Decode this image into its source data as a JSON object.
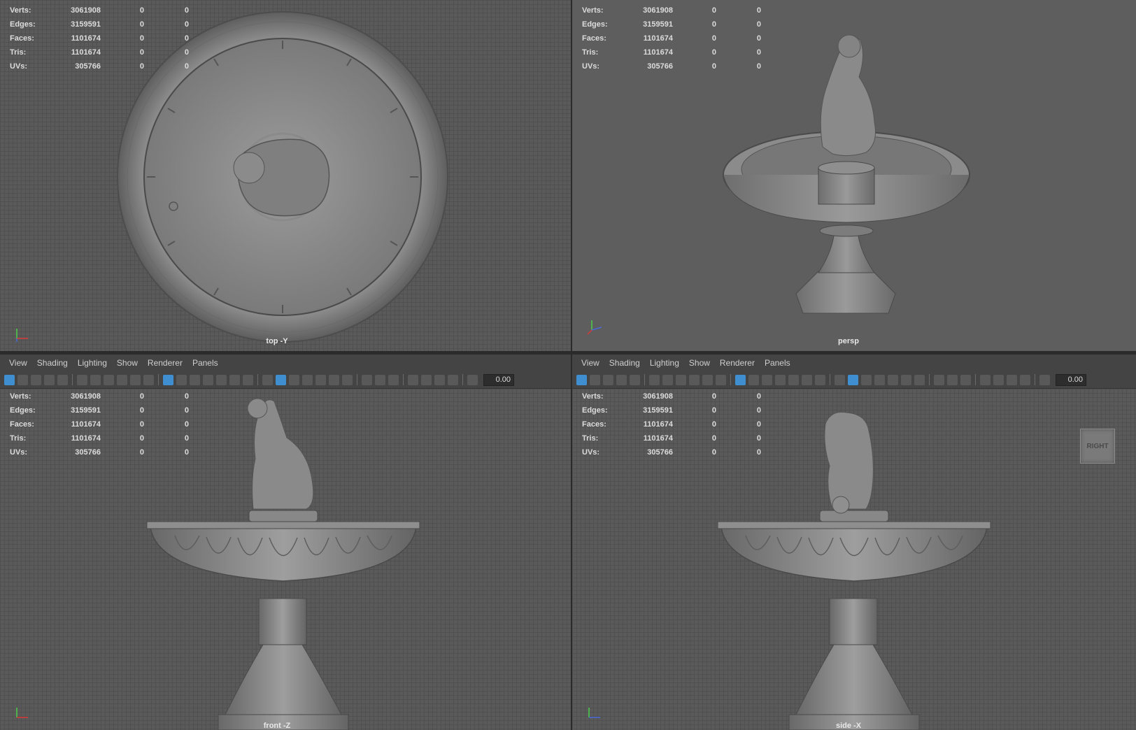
{
  "stats": {
    "rows": [
      {
        "label": "Verts:",
        "value": "3061908",
        "a": "0",
        "b": "0"
      },
      {
        "label": "Edges:",
        "value": "3159591",
        "a": "0",
        "b": "0"
      },
      {
        "label": "Faces:",
        "value": "1101674",
        "a": "0",
        "b": "0"
      },
      {
        "label": "Tris:",
        "value": "1101674",
        "a": "0",
        "b": "0"
      },
      {
        "label": "UVs:",
        "value": "305766",
        "a": "0",
        "b": "0"
      }
    ]
  },
  "panels": {
    "top": {
      "camera": "top -Y"
    },
    "persp": {
      "camera": "persp"
    },
    "front": {
      "camera": "front -Z"
    },
    "side": {
      "camera": "side -X",
      "viewcube": "RIGHT"
    }
  },
  "menu": {
    "view": "View",
    "shading": "Shading",
    "lighting": "Lighting",
    "show": "Show",
    "renderer": "Renderer",
    "panels": "Panels"
  },
  "toolbar": {
    "exposure_value": "0.00"
  },
  "icons": [
    "select-icon",
    "camera-icon",
    "grid-icon",
    "wireframe-icon",
    "shaded-icon",
    "light-icon",
    "isolate-icon",
    "exposure-icon"
  ],
  "colors": {
    "accent": "#3f8fd0",
    "axis_x": "#d83a3a",
    "axis_y": "#4ad04a",
    "axis_z": "#4a6ad8"
  }
}
